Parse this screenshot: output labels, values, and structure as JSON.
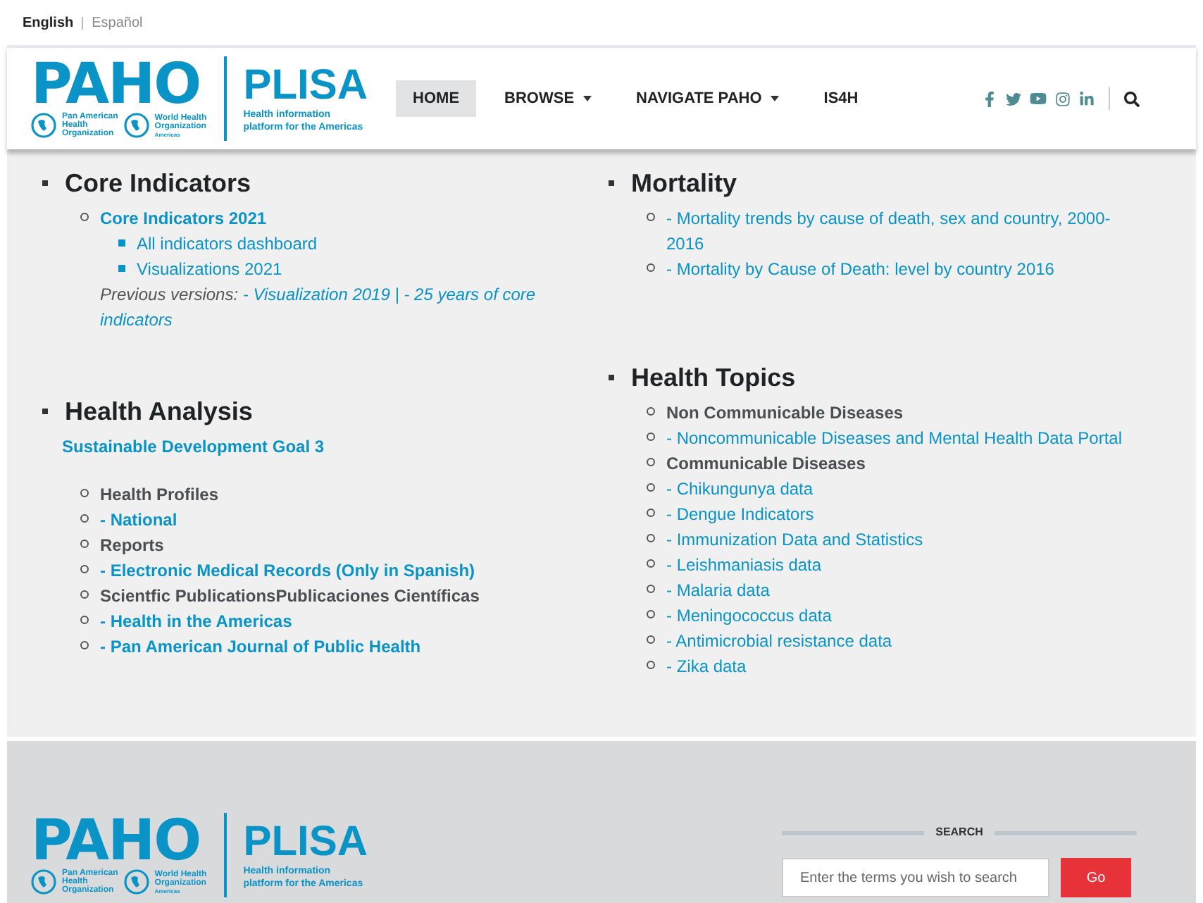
{
  "language_bar": [
    {
      "label": "English",
      "selected": true
    },
    {
      "label": "Español",
      "selected": false
    }
  ],
  "header": {
    "logo": {
      "acronym": "PAHO",
      "org1": [
        "Pan American",
        "Health",
        "Organization"
      ],
      "org2": [
        "World Health",
        "Organization"
      ],
      "org2_region": "Americas",
      "product": "PLISA",
      "tagline": [
        "Health information",
        "platform for the Americas"
      ]
    },
    "nav": [
      {
        "label": "HOME",
        "selected": true,
        "dropdown": false
      },
      {
        "label": "BROWSE",
        "selected": false,
        "dropdown": true
      },
      {
        "label": "NAVIGATE PAHO",
        "selected": false,
        "dropdown": true
      },
      {
        "label": "IS4H",
        "selected": false,
        "dropdown": false
      }
    ]
  },
  "columns": [
    [
      {
        "title": "Core Indicators",
        "items": [
          {
            "text": "Core Indicators 2021",
            "kind": "bold_link",
            "children": [
              {
                "text": "All indicators dashboard",
                "kind": "link"
              },
              {
                "text": "Visualizations 2021",
                "kind": "link"
              }
            ]
          }
        ],
        "previous_versions": {
          "label": "Previous versions:",
          "links": [
            "- Visualization 2019 |",
            "- 25 years of core indicators"
          ]
        }
      },
      {
        "title": "Health Analysis",
        "subtitle": "Sustainable Development Goal 3",
        "items": [
          {
            "text": "Health Profiles",
            "kind": "bold_label"
          },
          {
            "text": "- National",
            "kind": "bold_link"
          },
          {
            "text": "Reports",
            "kind": "bold_label"
          },
          {
            "text": "- Electronic Medical Records (Only in Spanish)",
            "kind": "bold_link"
          },
          {
            "text": "Scientfic PublicationsPublicaciones Científicas",
            "kind": "bold_label"
          },
          {
            "text": "- Health in the Americas",
            "kind": "bold_link"
          },
          {
            "text": "- Pan American Journal of Public Health",
            "kind": "bold_link"
          }
        ]
      }
    ],
    [
      {
        "title": "Mortality",
        "items": [
          {
            "text": "- Mortality trends by cause of death, sex and country, 2000-2016",
            "kind": "link"
          },
          {
            "text": "- Mortality by Cause of Death: level by country 2016",
            "kind": "link"
          }
        ]
      },
      {
        "title": "Health Topics",
        "items": [
          {
            "text": "Non Communicable Diseases",
            "kind": "bold_label"
          },
          {
            "text": "- Noncommunicable Diseases and Mental Health Data Portal",
            "kind": "link"
          },
          {
            "text": "Communicable Diseases",
            "kind": "bold_label"
          },
          {
            "text": "- Chikungunya data",
            "kind": "link"
          },
          {
            "text": "- Dengue Indicators",
            "kind": "link"
          },
          {
            "text": "- Immunization Data and Statistics",
            "kind": "link"
          },
          {
            "text": "- Leishmaniasis data",
            "kind": "link"
          },
          {
            "text": "- Malaria data",
            "kind": "link"
          },
          {
            "text": "- Meningococcus data",
            "kind": "link"
          },
          {
            "text": "- Antimicrobial resistance data",
            "kind": "link"
          },
          {
            "text": "- Zika data",
            "kind": "link"
          }
        ]
      }
    ]
  ],
  "footer": {
    "logo": {
      "acronym": "PAHO",
      "org1": [
        "Pan American",
        "Health",
        "Organization"
      ],
      "org2": [
        "World Health",
        "Organization"
      ],
      "org2_region": "Americas",
      "product": "PLISA",
      "tagline": [
        "Health information",
        "platform for the Americas"
      ]
    },
    "search": {
      "label": "SEARCH",
      "placeholder": "Enter the terms you wish to search",
      "button": "Go"
    }
  }
}
